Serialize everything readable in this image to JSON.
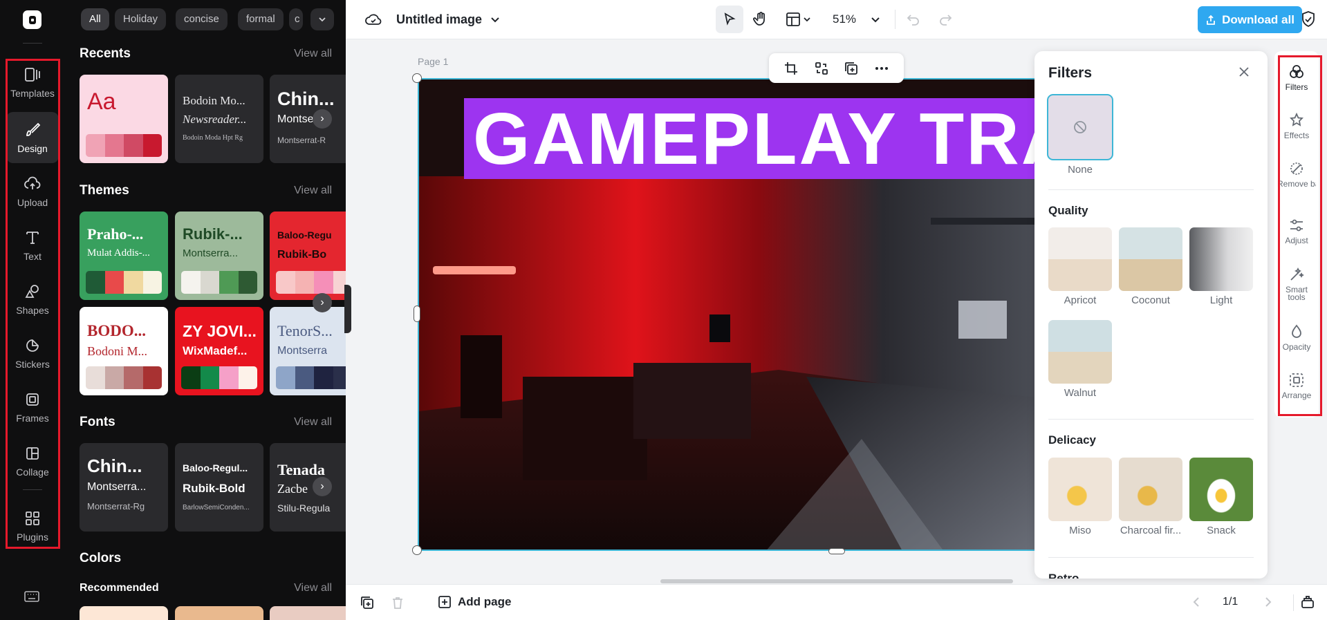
{
  "app": {
    "doc_title": "Untitled image",
    "zoom": "51%",
    "download_label": "Download all",
    "page_label": "Page 1"
  },
  "rail": {
    "items": [
      {
        "label": "Templates",
        "icon": "templates-icon"
      },
      {
        "label": "Design",
        "icon": "design-icon",
        "active": true
      },
      {
        "label": "Upload",
        "icon": "upload-icon"
      },
      {
        "label": "Text",
        "icon": "text-icon"
      },
      {
        "label": "Shapes",
        "icon": "shapes-icon"
      },
      {
        "label": "Stickers",
        "icon": "stickers-icon"
      },
      {
        "label": "Frames",
        "icon": "frames-icon"
      },
      {
        "label": "Collage",
        "icon": "collage-icon"
      },
      {
        "label": "Plugins",
        "icon": "plugins-icon"
      }
    ]
  },
  "panel": {
    "chips": [
      "All",
      "Holiday",
      "concise",
      "formal",
      "c"
    ],
    "recents": {
      "title": "Recents",
      "view_all": "View all",
      "cards": [
        {
          "l1": "Aa"
        },
        {
          "l1": "Bodoin Mo...",
          "l2": "Newsreader...",
          "l3": "Bodoin Moda Hpt Rg"
        },
        {
          "l1": "Chin...",
          "l2": "Montse",
          "l3": "Montserrat-R"
        }
      ]
    },
    "themes": {
      "title": "Themes",
      "view_all": "View all",
      "cards": [
        {
          "l1": "Praho-...",
          "l2": "Mulat Addis-...",
          "colors": [
            "#1f5a36",
            "#e84a4a",
            "#f0d9a0",
            "#f7f3e3"
          ]
        },
        {
          "l1": "Rubik-...",
          "l2": "Montserra...",
          "colors": [
            "#f5f3ee",
            "#d9d8d0",
            "#4f9a55",
            "#2e5a33"
          ]
        },
        {
          "l1": "Baloo-Regu",
          "l2": "Rubik-Bo",
          "colors": [
            "#f8c8c8",
            "#f5b3b3",
            "#f58fb8",
            "#f7d3d3"
          ]
        },
        {
          "l1": "BODO...",
          "l2": "Bodoni M...",
          "colors": [
            "#e8ddd9",
            "#c9a9a6",
            "#b56a6a",
            "#a83232"
          ]
        },
        {
          "l1": "ZY JOVI...",
          "l2": "WixMadef...",
          "colors": [
            "#0b3d14",
            "#138a4a",
            "#f5a0c8",
            "#fdf2e9"
          ]
        },
        {
          "l1": "TenorS...",
          "l2": "Montserra",
          "colors": [
            "#8ea5c8",
            "#4a5a80",
            "#1f2340",
            "#2a2f4a"
          ]
        }
      ]
    },
    "fonts": {
      "title": "Fonts",
      "view_all": "View all",
      "cards": [
        {
          "l1": "Chin...",
          "l2": "Montserra...",
          "l3": "Montserrat-Rg"
        },
        {
          "l1": "Baloo-Regul...",
          "l2": "Rubik-Bold",
          "l3": "BarlowSemiConden..."
        },
        {
          "l1": "Tenada",
          "l2": "Zacbe",
          "l3": "Stilu-Regula"
        }
      ]
    },
    "colors": {
      "title": "Colors",
      "recommended": "Recommended",
      "view_all": "View all"
    }
  },
  "canvas": {
    "banner_text": "GAMEPLAY TRA",
    "banner_color": "#9d34f0"
  },
  "filters": {
    "title": "Filters",
    "none_label": "None",
    "sections": [
      {
        "title": "Quality",
        "items": [
          "Apricot",
          "Coconut",
          "Light",
          "Walnut"
        ]
      },
      {
        "title": "Delicacy",
        "items": [
          "Miso",
          "Charcoal fir...",
          "Snack"
        ]
      },
      {
        "title": "Retro"
      }
    ]
  },
  "right_rail": {
    "items": [
      {
        "label": "Filters",
        "icon": "filters-icon",
        "active": true
      },
      {
        "label": "Effects",
        "icon": "effects-icon"
      },
      {
        "label": "Remove backgr...",
        "icon": "remove-background-icon"
      },
      {
        "label": "Adjust",
        "icon": "adjust-icon"
      },
      {
        "label": "Smart tools",
        "icon": "smart-tools-icon"
      },
      {
        "label": "Opacity",
        "icon": "opacity-icon"
      },
      {
        "label": "Arrange",
        "icon": "arrange-icon"
      }
    ]
  },
  "bottom": {
    "add_page": "Add page",
    "page_counter": "1/1"
  }
}
